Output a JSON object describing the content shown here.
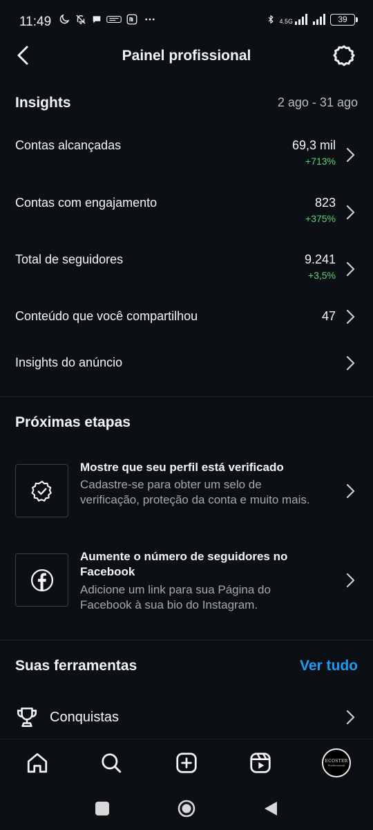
{
  "status_bar": {
    "time": "11:49",
    "network": "4.5G",
    "battery": "39"
  },
  "header": {
    "title": "Painel profissional"
  },
  "insights": {
    "title": "Insights",
    "date_range": "2 ago - 31 ago",
    "rows": [
      {
        "label": "Contas alcançadas",
        "value": "69,3 mil",
        "change": "+713%"
      },
      {
        "label": "Contas com engajamento",
        "value": "823",
        "change": "+375%"
      },
      {
        "label": "Total de seguidores",
        "value": "9.241",
        "change": "+3,5%"
      },
      {
        "label": "Conteúdo que você compartilhou",
        "value": "47",
        "change": ""
      },
      {
        "label": "Insights do anúncio",
        "value": "",
        "change": ""
      }
    ]
  },
  "next_steps": {
    "title": "Próximas etapas",
    "cards": [
      {
        "icon": "verified-badge-icon",
        "title": "Mostre que seu perfil está verificado",
        "description": "Cadastre-se para obter um selo de verificação, proteção da conta e muito mais."
      },
      {
        "icon": "facebook-icon",
        "title": "Aumente o número de seguidores no Facebook",
        "description": "Adicione um link para sua Página do Facebook à sua bio do Instagram."
      }
    ]
  },
  "tools": {
    "title": "Suas ferramentas",
    "see_all": "Ver tudo",
    "items": [
      {
        "icon": "trophy-icon",
        "label": "Conquistas"
      }
    ]
  },
  "bottom_nav": {
    "items": [
      "home-icon",
      "search-icon",
      "create-icon",
      "reels-icon",
      "profile-avatar"
    ],
    "avatar_text": "ECOSTER",
    "avatar_subtext": "Professional"
  },
  "colors": {
    "background": "#0c1014",
    "text": "#f5f5f5",
    "secondary_text": "#a8a8a8",
    "positive_change": "#5fd07a",
    "link": "#1d9bf0"
  }
}
